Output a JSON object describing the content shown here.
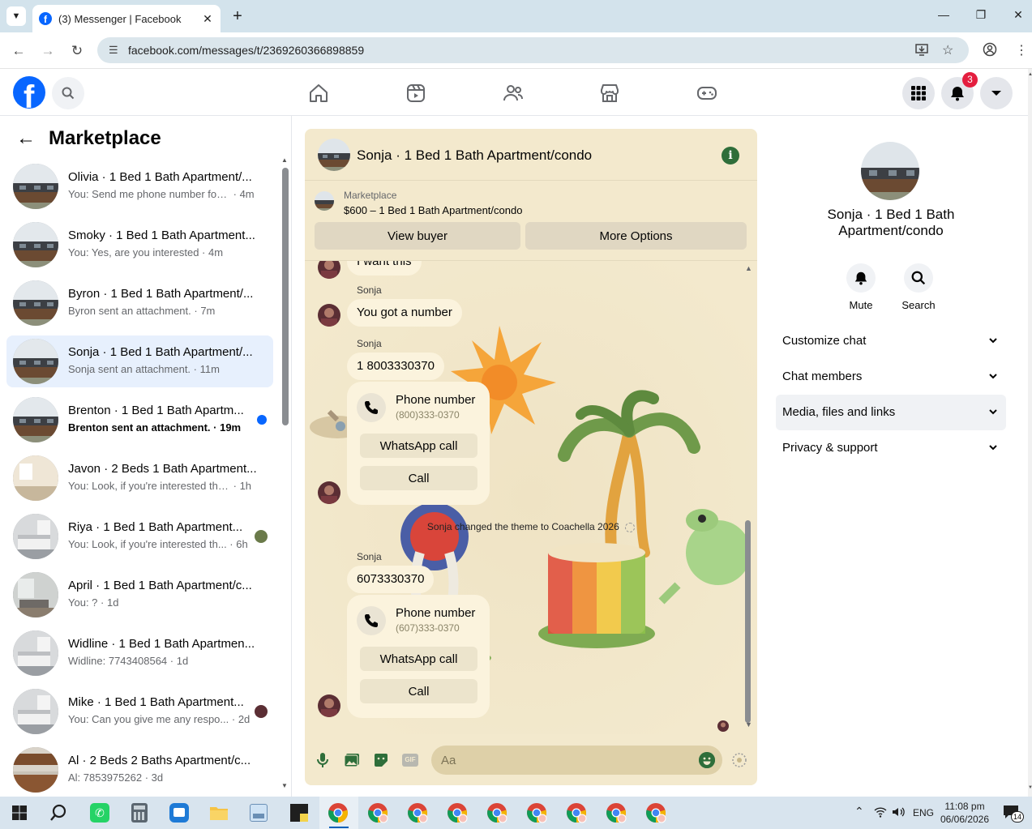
{
  "browser": {
    "tab_title": "(3) Messenger | Facebook",
    "url": "facebook.com/messages/t/2369260366898859"
  },
  "header": {
    "notification_count": "3"
  },
  "sidebar": {
    "title": "Marketplace",
    "conversations": [
      {
        "name": "Olivia · 1 Bed 1 Bath Apartment/...",
        "snippet": "You: Send me phone number for c...",
        "time": "4m",
        "thumb": "building"
      },
      {
        "name": "Smoky · 1 Bed 1 Bath Apartment...",
        "snippet": "You: Yes, are you interested",
        "time": "4m",
        "thumb": "building"
      },
      {
        "name": "Byron · 1 Bed 1 Bath Apartment/...",
        "snippet": "Byron sent an attachment.",
        "time": "7m",
        "thumb": "building"
      },
      {
        "name": "Sonja · 1 Bed 1 Bath Apartment/...",
        "snippet": "Sonja sent an attachment.",
        "time": "11m",
        "thumb": "building",
        "active": true
      },
      {
        "name": "Brenton · 1 Bed 1 Bath Apartm...",
        "snippet": "Brenton sent an attachment.",
        "time": "19m",
        "thumb": "building",
        "unread": true
      },
      {
        "name": "Javon · 2 Beds 1 Bath Apartment...",
        "snippet": "You: Look, if you're interested then ...",
        "time": "1h",
        "thumb": "room-light"
      },
      {
        "name": "Riya · 1 Bed 1 Bath Apartment...",
        "snippet": "You: Look, if you're interested th...",
        "time": "6h",
        "thumb": "room-bed"
      },
      {
        "name": "April · 1 Bed 1 Bath Apartment/c...",
        "snippet": "You: ?",
        "time": "1d",
        "thumb": "room-living"
      },
      {
        "name": "Widline · 1 Bed 1 Bath Apartmen...",
        "snippet": "Widline: 7743408564",
        "time": "1d",
        "thumb": "room-bed"
      },
      {
        "name": "Mike · 1 Bed 1 Bath Apartment...",
        "snippet": "You: Can you give me any respo...",
        "time": "2d",
        "thumb": "room-bed"
      },
      {
        "name": "Al · 2 Beds 2 Baths Apartment/c...",
        "snippet": "Al: 7853975262",
        "time": "3d",
        "thumb": "kitchen"
      }
    ]
  },
  "chat": {
    "title": "Sonja · 1 Bed 1 Bath Apartment/condo",
    "listing_label": "Marketplace",
    "listing_title": "$600 – 1 Bed 1 Bath Apartment/condo",
    "view_buyer": "View buyer",
    "more_options": "More Options",
    "partial_message": "I want this",
    "sender_name": "Sonja",
    "message_1": "You got a number",
    "message_2": "1 8003330370",
    "card_1": {
      "title": "Phone number",
      "number": "(800)333-0370",
      "whatsapp": "WhatsApp call",
      "call": "Call"
    },
    "system_note": "Sonja changed the theme to Coachella 2026",
    "message_3": "6073330370",
    "card_2": {
      "title": "Phone number",
      "number": "(607)333-0370",
      "whatsapp": "WhatsApp call",
      "call": "Call"
    },
    "composer_placeholder": "Aa",
    "gif_label": "GIF",
    "theme_colors": {
      "background": "#f3e9cd",
      "bubble": "#fbf3dd",
      "accent": "#2e6e3a"
    }
  },
  "info_panel": {
    "name_line1": "Sonja · 1 Bed 1 Bath",
    "name_line2": "Apartment/condo",
    "mute": "Mute",
    "search": "Search",
    "rows": [
      "Customize chat",
      "Chat members",
      "Media, files and links",
      "Privacy & support"
    ]
  },
  "taskbar": {
    "language": "ENG",
    "time": "11:08 pm",
    "date": "06/06/2026",
    "notification_count": "14"
  }
}
